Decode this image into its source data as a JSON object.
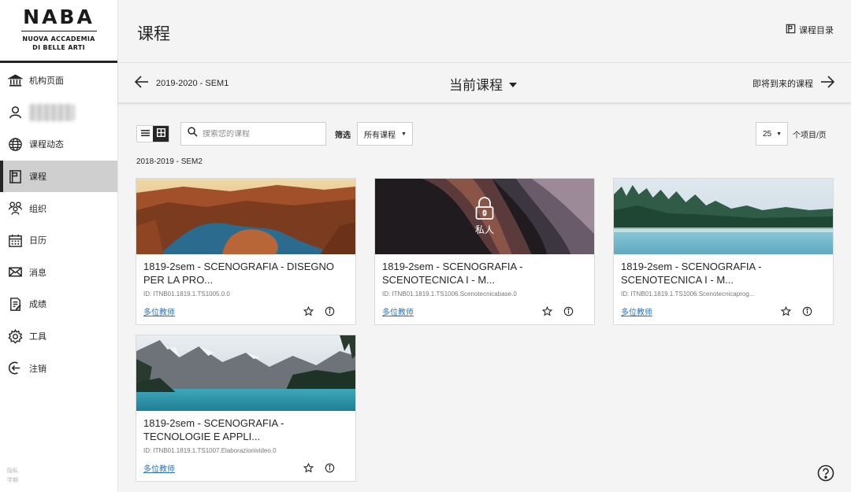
{
  "logo": {
    "main": "NABA",
    "line1": "NUOVA ACCADEMIA",
    "line2": "DI BELLE ARTI"
  },
  "sidebar": {
    "items": [
      {
        "label": "机构页面",
        "icon": "institution-icon"
      },
      {
        "label": "",
        "icon": "user-icon"
      },
      {
        "label": "课程动态",
        "icon": "globe-icon"
      },
      {
        "label": "课程",
        "icon": "courses-icon",
        "active": true
      },
      {
        "label": "组织",
        "icon": "groups-icon"
      },
      {
        "label": "日历",
        "icon": "calendar-icon"
      },
      {
        "label": "消息",
        "icon": "envelope-icon"
      },
      {
        "label": "成绩",
        "icon": "grades-icon"
      },
      {
        "label": "工具",
        "icon": "gear-icon"
      },
      {
        "label": "注销",
        "icon": "logout-icon"
      }
    ],
    "footer": {
      "line1": "隐私",
      "line2": "学期"
    }
  },
  "header": {
    "title": "课程",
    "catalog_label": "课程目录"
  },
  "termbar": {
    "prev": "2019-2020 - SEM1",
    "current": "当前课程",
    "next": "即将到来的课程"
  },
  "toolbar": {
    "search_placeholder": "搜索您的课程",
    "filter_label": "筛选",
    "filter_value": "所有课程",
    "per_page_value": "25",
    "per_page_label": "个项目/页"
  },
  "term_label": "2018-2019 - SEM2",
  "courses": [
    {
      "title": "1819-2sem - SCENOGRAFIA - DISEGNO PER LA PRO...",
      "id": "ID: ITNB01.1819.1.TS1005.0.0",
      "teachers": "多位教师",
      "private": false
    },
    {
      "title": "1819-2sem - SCENOGRAFIA - SCENOTECNICA I - M...",
      "id": "ID: ITNB01.1819.1.TS1006.Scenotecnicabase.0",
      "teachers": "多位教师",
      "private": true,
      "private_label": "私人"
    },
    {
      "title": "1819-2sem - SCENOGRAFIA - SCENOTECNICA I - M...",
      "id": "ID: ITNB01.1819.1.TS1006.Scenotecnicaprog...",
      "teachers": "多位教师",
      "private": false
    },
    {
      "title": "1819-2sem - SCENOGRAFIA - TECNOLOGIE E APPLI...",
      "id": "ID: ITNB01.1819.1.TS1007.Elaborazionivideo.0",
      "teachers": "多位教师",
      "private": false
    }
  ],
  "colors": {
    "link": "#2a72b8",
    "active_nav": "#cfcfcf",
    "text": "#262626"
  }
}
